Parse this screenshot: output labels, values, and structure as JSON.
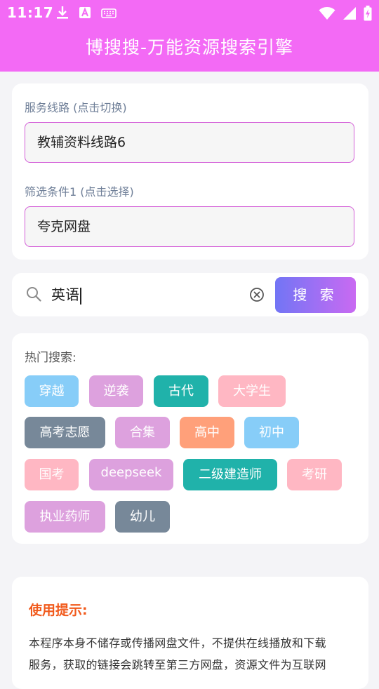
{
  "status_bar": {
    "time": "11:17",
    "icons_left": [
      "download-icon",
      "font-a-icon",
      "keyboard-icon"
    ],
    "icons_right": [
      "wifi-icon",
      "signal-icon",
      "battery-charging-icon"
    ]
  },
  "header": {
    "title": "博搜搜-万能资源搜索引擎"
  },
  "settings": {
    "line_label": "服务线路 (点击切换)",
    "line_value": "教辅资料线路6",
    "filter_label": "筛选条件1 (点击选择)",
    "filter_value": "夸克网盘"
  },
  "search": {
    "query": "英语",
    "button_label": "搜 索"
  },
  "hot": {
    "title": "热门搜索:",
    "tags": [
      "穿越",
      "逆袭",
      "古代",
      "大学生",
      "高考志愿",
      "合集",
      "高中",
      "初中",
      "国考",
      "deepseek",
      "二级建造师",
      "考研",
      "执业药师",
      "幼儿"
    ]
  },
  "tips": {
    "title": "使用提示:",
    "lines": [
      "本程序本身不储存或传播网盘文件，不提供在线播放和下载",
      "服务，获取的链接会跳转至第三方网盘，资源文件为互联网"
    ]
  },
  "colors": {
    "brand": "#f36af5",
    "field_border": "#d45fd8",
    "button_gradient": [
      "#7275f5",
      "#c96af2"
    ],
    "tips_title": "#f15a1c",
    "tag_blue": "#87cdf8",
    "tag_purple": "#dda1de",
    "tag_teal": "#20b2aa",
    "tag_pink": "#ffb7c3",
    "tag_slate": "#778899",
    "tag_orange": "#ffa07a"
  }
}
